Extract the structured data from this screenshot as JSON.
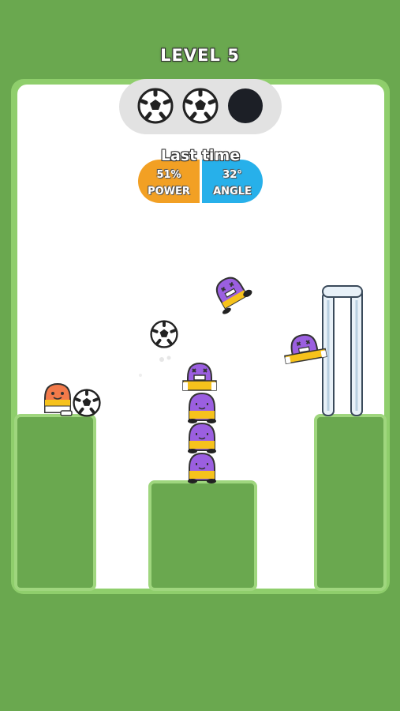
{
  "level": {
    "title": "LEVEL 5"
  },
  "shots": {
    "balls": [
      {
        "state": "available",
        "icon": "soccer-ball-icon"
      },
      {
        "state": "available",
        "icon": "soccer-ball-icon"
      },
      {
        "state": "used",
        "icon": "empty-ball-slot-icon"
      }
    ]
  },
  "last_time": {
    "title": "Last time",
    "power_value": "51%",
    "power_label": "POWER",
    "angle_value": "32°",
    "angle_label": "ANGLE"
  },
  "colors": {
    "background_green": "#6aa84f",
    "power_orange": "#f2a024",
    "angle_blue": "#27b0ea",
    "defender_purple": "#9b5fe0",
    "defender_shorts_yellow": "#f6c21c",
    "player_orange": "#f27a4a"
  }
}
